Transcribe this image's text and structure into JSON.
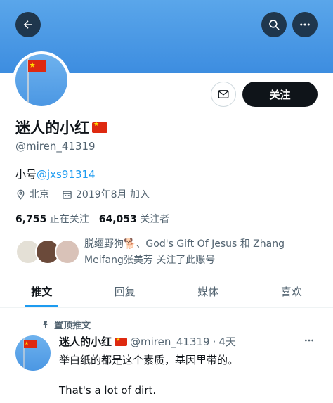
{
  "header": {
    "icons": [
      "back-arrow-icon",
      "search-icon",
      "more-icon"
    ]
  },
  "profile": {
    "name": "迷人的小红",
    "handle": "@miren_41319",
    "bio_prefix": "小号",
    "bio_link": "@jxs91314",
    "location": "北京",
    "joined": "2019年8月 加入",
    "following_count": "6,755",
    "following_label": "正在关注",
    "followers_count": "64,053",
    "followers_label": "关注者",
    "follow_label": "关注",
    "known_followers": "脱缰野狗🐕、God's Gift Of Jesus 和 Zhang Meifang张美芳 关注了此账号"
  },
  "tabs": [
    "推文",
    "回复",
    "媒体",
    "喜欢"
  ],
  "pinned_tweet": {
    "pinned_label": "置顶推文",
    "name": "迷人的小红",
    "handle": "@miren_41319",
    "separator": "·",
    "time": "4天",
    "text_line1": "举白纸的都是这个素质，基因里带的。",
    "text_line2": "That's a lot of dirt."
  },
  "colors": {
    "accent": "#1d9bf0",
    "banner": "#4a99e6",
    "button_dark": "#0f1419",
    "flag_red": "#de2910"
  }
}
